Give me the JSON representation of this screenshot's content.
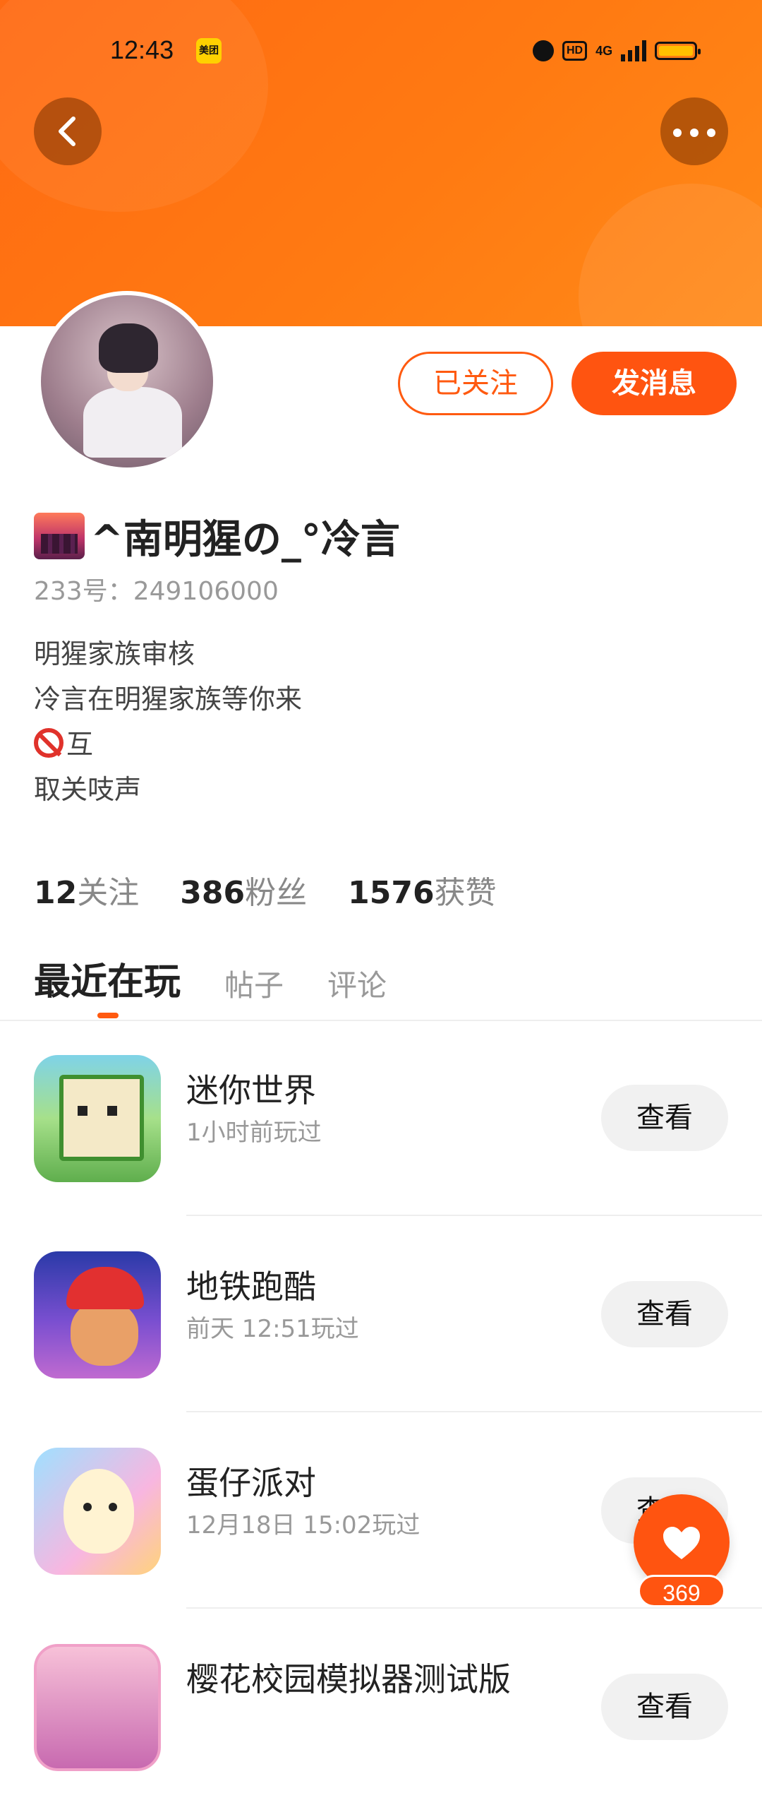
{
  "status_bar": {
    "time": "12:43",
    "app_badge": "美团",
    "hd": "HD",
    "network": "4G"
  },
  "profile": {
    "follow_button": "已关注",
    "message_button": "发消息",
    "name": "^南明猩の_°冷言",
    "uid": "233号：249106000",
    "bio_lines": [
      "明猩家族审核",
      "冷言在明猩家族等你来",
      "互",
      "取关吱声"
    ]
  },
  "stats": {
    "following": {
      "num": "12",
      "label": "关注"
    },
    "fans": {
      "num": "386",
      "label": "粉丝"
    },
    "likes": {
      "num": "1576",
      "label": "获赞"
    }
  },
  "tabs": [
    "最近在玩",
    "帖子",
    "评论"
  ],
  "games": [
    {
      "name": "迷你世界",
      "time": "1小时前玩过",
      "button": "查看"
    },
    {
      "name": "地铁跑酷",
      "time": "前天 12:51玩过",
      "button": "查看"
    },
    {
      "name": "蛋仔派对",
      "time": "12月18日 15:02玩过",
      "button": "查看"
    },
    {
      "name": "樱花校园模拟器测试版",
      "time": "",
      "button": "查看"
    }
  ],
  "fab": {
    "count": "369"
  },
  "colors": {
    "accent": "#ff5410",
    "banner": "#ff7a12"
  }
}
